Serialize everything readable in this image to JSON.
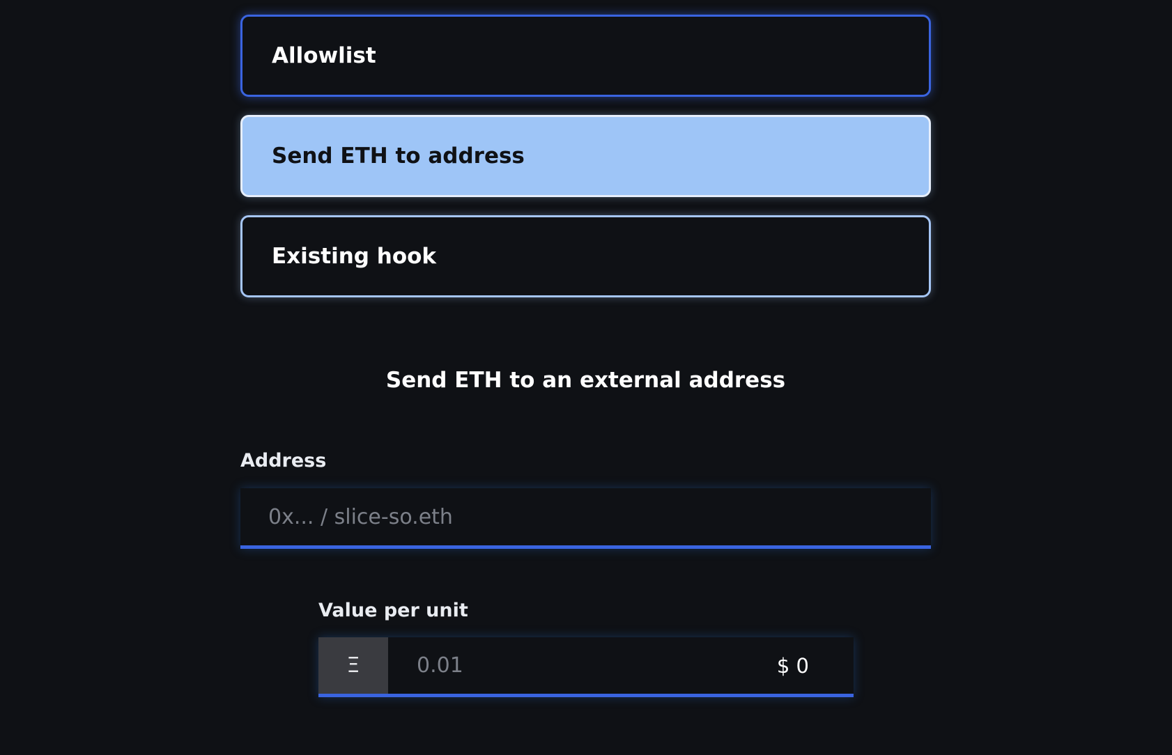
{
  "hook_options": {
    "allowlist_label": "Allowlist",
    "send_eth_label": "Send ETH to address",
    "existing_hook_label": "Existing hook",
    "selected": "Send ETH to address"
  },
  "section": {
    "title": "Send ETH to an external address"
  },
  "address_field": {
    "label": "Address",
    "value": "",
    "placeholder": "0x... / slice-so.eth"
  },
  "value_field": {
    "label": "Value per unit",
    "currency_symbol": "Ξ",
    "currency_icon": "ethereum-icon",
    "value": "",
    "placeholder": "0.01",
    "usd_display": "$ 0"
  },
  "colors": {
    "background": "#0f1115",
    "accent": "#3a64e0",
    "selected_fill": "#9ec5f7"
  }
}
